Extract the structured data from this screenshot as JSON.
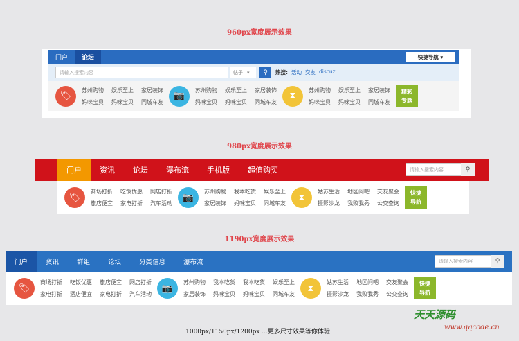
{
  "section1": {
    "title": "960px宽度展示效果",
    "nav": [
      "门户",
      "论坛"
    ],
    "quick_nav": "快捷导航 ▾",
    "search_placeholder": "请输入搜索内容",
    "search_type": "帖子",
    "hot_label": "热搜:",
    "hot": [
      "活动",
      "交友",
      "discuz"
    ],
    "groups": [
      [
        "苏州购物",
        "娱乐至上",
        "家居装饰",
        "妈咪宝贝",
        "妈咪宝贝",
        "同城车友"
      ],
      [
        "苏州购物",
        "娱乐至上",
        "家居装饰",
        "妈咪宝贝",
        "妈咪宝贝",
        "同城车友"
      ],
      [
        "苏州购物",
        "娱乐至上",
        "家居装饰",
        "妈咪宝贝",
        "妈咪宝贝",
        "同城车友"
      ]
    ],
    "special": [
      "精彩",
      "专题"
    ]
  },
  "section2": {
    "title": "980px宽度展示效果",
    "nav": [
      "门户",
      "资讯",
      "论坛",
      "瀑布流",
      "手机版",
      "超值购买"
    ],
    "search_placeholder": "请输入搜索内容",
    "groups": [
      [
        "商场打折",
        "吃饭优惠",
        "网店打折",
        "旅店便宜",
        "家电打折",
        "汽车活动"
      ],
      [
        "苏州购物",
        "我本吃货",
        "娱乐至上",
        "家居装饰",
        "妈咪宝贝",
        "同城车友"
      ],
      [
        "姑苏生活",
        "地区问吧",
        "交友聚会",
        "摄影沙龙",
        "我败我秀",
        "公交查询"
      ]
    ],
    "special": [
      "快捷",
      "导航"
    ]
  },
  "section3": {
    "title": "1190px宽度展示效果",
    "nav": [
      "门户",
      "资讯",
      "群组",
      "论坛",
      "分类信息",
      "瀑布流"
    ],
    "search_placeholder": "请输入搜索内容",
    "groups": [
      [
        "商场打折",
        "吃饭优惠",
        "旅店便宜",
        "网店打折",
        "家电打折",
        "酒店便宜",
        "家电打折",
        "汽车活动"
      ],
      [
        "苏州购物",
        "我本吃货",
        "我本吃货",
        "娱乐至上",
        "家居装饰",
        "妈咪宝贝",
        "妈咪宝贝",
        "同城车友"
      ],
      [
        "姑苏生活",
        "地区问吧",
        "交友聚会",
        "摄影沙龙",
        "我败我秀",
        "公交查询"
      ]
    ],
    "special": [
      "快捷",
      "导航"
    ]
  },
  "footer": "1000px/1150px/1200px ...更多尺寸效果等你体验",
  "watermark": [
    "天天源码",
    "www.qqcode.cn"
  ],
  "colors": {
    "blue": "#2a6cc0",
    "red": "#d0121a",
    "orange": "#f39800",
    "green": "#8cb72b",
    "tag": "#e65540",
    "camera": "#3bb5e2",
    "hourglass": "#f2c438"
  }
}
